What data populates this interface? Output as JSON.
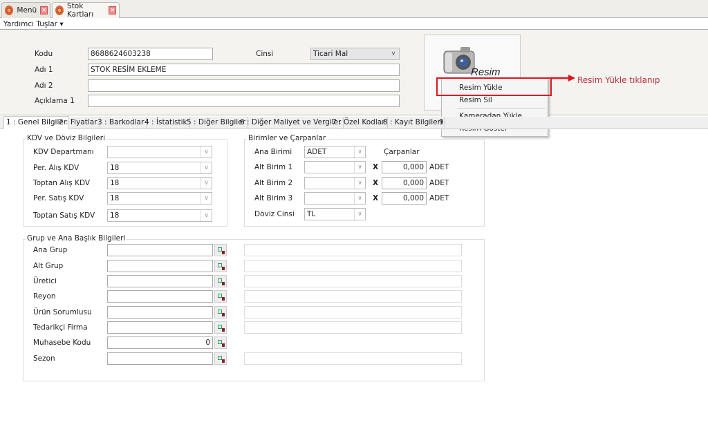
{
  "doc_tabs": [
    {
      "label": "Menü",
      "active": false
    },
    {
      "label": "Stok Kartları",
      "active": true
    }
  ],
  "helper_menu": "Yardımcı Tuşlar ▾",
  "header": {
    "kodu_label": "Kodu",
    "kodu_value": "8688624603238",
    "cinsi_label": "Cinsi",
    "cinsi_value": "Ticari Mal",
    "adi1_label": "Adı 1",
    "adi1_value": "STOK RESİM EKLEME",
    "adi2_label": "Adı 2",
    "adi2_value": "",
    "aciklama_label": "Açıklama 1",
    "aciklama_value": ""
  },
  "image": {
    "label": "Resim",
    "icon": "camera-icon"
  },
  "context_menu": [
    "Resim Yükle",
    "Resim Sil",
    "Kameradan Yükle",
    "Resim Göster"
  ],
  "annotation": {
    "text": "Resim Yükle tıklanıp",
    "color": "#e0141e"
  },
  "tabs": [
    "1 : Genel Bilgiler",
    "2 : Fiyatlar",
    "3 : Barkodlar",
    "4 : İstatistik",
    "5 : Diğer Bilgiler",
    "6 : Diğer Maliyet ve Vergiler",
    "7 : Özel Kodlar",
    "8 : Kayıt Bilgileri",
    "9"
  ],
  "kdv": {
    "title": "KDV ve Döviz Bilgileri",
    "rows": [
      {
        "label": "KDV Departmanı",
        "value": ""
      },
      {
        "label": "Per. Alış KDV",
        "value": "18"
      },
      {
        "label": "Toptan Alış KDV",
        "value": "18"
      },
      {
        "label": "Per. Satış KDV",
        "value": "18"
      },
      {
        "label": "Toptan Satış KDV",
        "value": "18"
      }
    ]
  },
  "birimler": {
    "title": "Birimler ve Çarpanlar",
    "carpanlar_label": "Çarpanlar",
    "ana_label": "Ana Birimi",
    "ana_value": "ADET",
    "alt": [
      {
        "label": "Alt Birim 1",
        "value": "",
        "mult": "0,000",
        "unit": "ADET"
      },
      {
        "label": "Alt Birim 2",
        "value": "",
        "mult": "0,000",
        "unit": "ADET"
      },
      {
        "label": "Alt Birim 3",
        "value": "",
        "mult": "0,000",
        "unit": "ADET"
      }
    ],
    "x": "X",
    "doviz_label": "Döviz Cinsi",
    "doviz_value": "TL"
  },
  "grup": {
    "title": "Grup ve Ana Başlık Bilgileri",
    "rows": [
      {
        "label": "Ana Grup",
        "value": "",
        "desc": ""
      },
      {
        "label": "Alt Grup",
        "value": "",
        "desc": ""
      },
      {
        "label": "Üretici",
        "value": "",
        "desc": ""
      },
      {
        "label": "Reyon",
        "value": "",
        "desc": ""
      },
      {
        "label": "Ürün Sorumlusu",
        "value": "",
        "desc": ""
      },
      {
        "label": "Tedarikçi Firma",
        "value": "",
        "desc": ""
      },
      {
        "label": "Muhasebe Kodu",
        "value": "0"
      },
      {
        "label": "Sezon",
        "value": "",
        "desc": ""
      }
    ]
  }
}
